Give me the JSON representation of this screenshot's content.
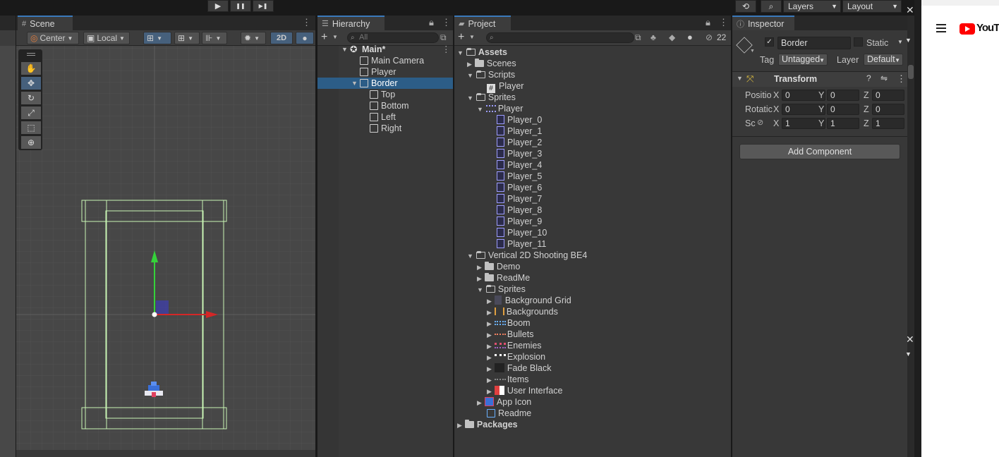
{
  "toolbar": {
    "play": "▶",
    "pause": "❚❚",
    "step": "▶❚",
    "layers": "Layers",
    "layout": "Layout"
  },
  "scene": {
    "tab": "Scene",
    "pivot": "Center",
    "space": "Local",
    "mode2d": "2D"
  },
  "hierarchy": {
    "tab": "Hierarchy",
    "search_placeholder": "All",
    "items": [
      {
        "label": "Main*"
      },
      {
        "label": "Main Camera"
      },
      {
        "label": "Player"
      },
      {
        "label": "Border"
      },
      {
        "label": "Top"
      },
      {
        "label": "Bottom"
      },
      {
        "label": "Left"
      },
      {
        "label": "Right"
      }
    ]
  },
  "project": {
    "tab": "Project",
    "hidden_count": "22",
    "items": [
      {
        "label": "Assets"
      },
      {
        "label": "Scenes"
      },
      {
        "label": "Scripts"
      },
      {
        "label": "Player"
      },
      {
        "label": "Sprites"
      },
      {
        "label": "Player"
      },
      {
        "label": "Player_0"
      },
      {
        "label": "Player_1"
      },
      {
        "label": "Player_2"
      },
      {
        "label": "Player_3"
      },
      {
        "label": "Player_4"
      },
      {
        "label": "Player_5"
      },
      {
        "label": "Player_6"
      },
      {
        "label": "Player_7"
      },
      {
        "label": "Player_8"
      },
      {
        "label": "Player_9"
      },
      {
        "label": "Player_10"
      },
      {
        "label": "Player_11"
      },
      {
        "label": "Vertical 2D Shooting BE4"
      },
      {
        "label": "Demo"
      },
      {
        "label": "ReadMe"
      },
      {
        "label": "Sprites"
      },
      {
        "label": "Background Grid"
      },
      {
        "label": "Backgrounds"
      },
      {
        "label": "Boom"
      },
      {
        "label": "Bullets"
      },
      {
        "label": "Enemies"
      },
      {
        "label": "Explosion"
      },
      {
        "label": "Fade Black"
      },
      {
        "label": "Items"
      },
      {
        "label": "User Interface"
      },
      {
        "label": "App Icon"
      },
      {
        "label": "Readme"
      },
      {
        "label": "Packages"
      }
    ]
  },
  "inspector": {
    "tab": "Inspector",
    "object_name": "Border",
    "static_label": "Static",
    "tag_label": "Tag",
    "tag_value": "Untagged",
    "layer_label": "Layer",
    "layer_value": "Default",
    "transform_title": "Transform",
    "position_label": "Positio",
    "rotation_label": "Rotatic",
    "scale_label": "Sc",
    "axis_x": "X",
    "axis_y": "Y",
    "axis_z": "Z",
    "position": [
      "0",
      "0",
      "0"
    ],
    "rotation": [
      "0",
      "0",
      "0"
    ],
    "scale": [
      "1",
      "1",
      "1"
    ],
    "add_component": "Add Component"
  },
  "browser": {
    "logo_text": "YouTu"
  },
  "colors": {
    "selection": "#2c5d87",
    "tab_accent": "#3a79bb",
    "border_gizmo": "#c8f5b4",
    "axis_y": "#35d23a",
    "axis_x": "#d42727"
  }
}
